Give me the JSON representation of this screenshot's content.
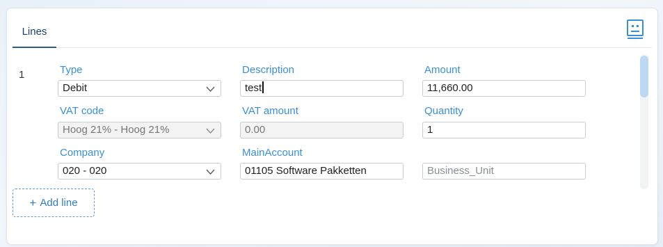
{
  "tabs": [
    {
      "label": "Lines"
    }
  ],
  "line": {
    "number": "1",
    "type": {
      "label": "Type",
      "value": "Debit"
    },
    "description": {
      "label": "Description",
      "value": "test"
    },
    "amount": {
      "label": "Amount",
      "value": "11,660.00"
    },
    "vat_code": {
      "label": "VAT code",
      "value": "Hoog 21% - Hoog 21%"
    },
    "vat_amount": {
      "label": "VAT amount",
      "value": "0.00"
    },
    "quantity": {
      "label": "Quantity",
      "value": "1"
    },
    "company": {
      "label": "Company",
      "value": "020 - 020"
    },
    "main_account": {
      "label": "MainAccount",
      "value": "01105 Software Pakketten"
    },
    "business_unit": {
      "placeholder": "Business_Unit",
      "value": ""
    }
  },
  "actions": {
    "add_line_label": "Add line"
  },
  "colors": {
    "accent": "#3b8fd6",
    "tab_active": "#2b5a8c",
    "scroll_thumb": "#bcd8f3"
  },
  "icons": {
    "toggle": "view-toggle-icon",
    "chevron": "chevron-down-icon",
    "add": "plus-icon"
  }
}
